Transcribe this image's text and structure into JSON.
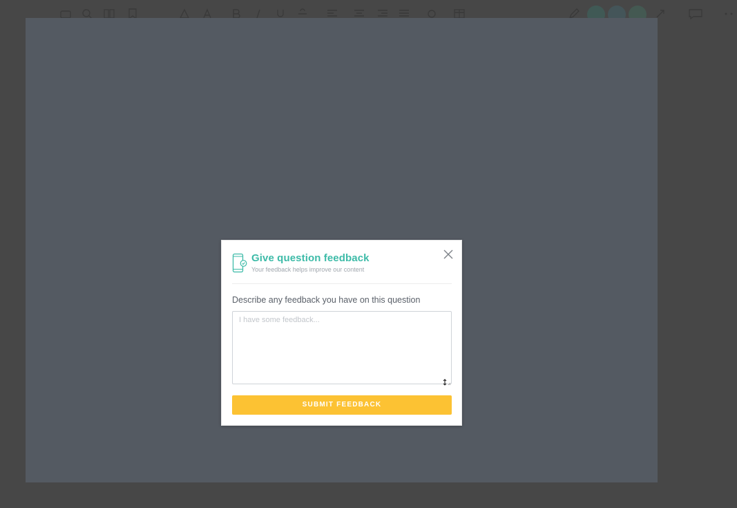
{
  "colors": {
    "backdrop": "#474747",
    "canvas_dimmed": "#545a62",
    "accent_teal": "#3dbba8",
    "submit_yellow": "#fcc233"
  },
  "toolbar": {
    "icons": [
      "camera-icon",
      "search-icon",
      "book-icon",
      "bookmark-icon",
      "triangle-shape-icon",
      "text-color-icon",
      "bold-icon",
      "italic-icon",
      "underline-icon",
      "strikethrough-icon",
      "align-left-icon",
      "align-center-icon",
      "align-right-icon",
      "align-justify-icon",
      "link-icon",
      "table-icon",
      "pencil-icon",
      "collaborator-avatar",
      "collaborator-avatar",
      "collaborator-avatar",
      "expand-icon",
      "comment-icon",
      "more-icon"
    ]
  },
  "modal": {
    "title": "Give question feedback",
    "subtitle": "Your feedback helps improve our content",
    "header_icon": "phone-check-icon",
    "close_icon": "close-icon",
    "field_label": "Describe any feedback you have on this question",
    "input_placeholder": "I have some feedback...",
    "input_value": "",
    "submit_label": "SUBMIT FEEDBACK"
  }
}
